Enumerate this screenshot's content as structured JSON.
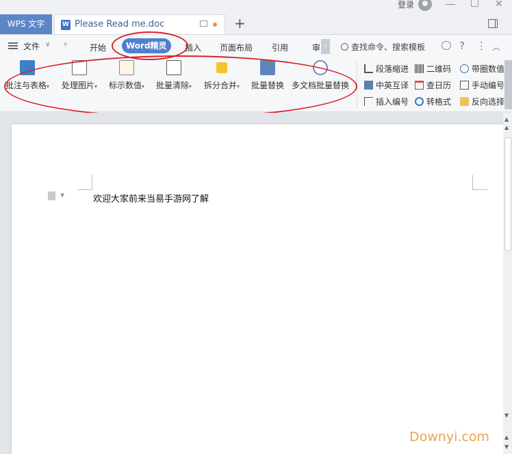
{
  "titlebar": {
    "app_tab": "WPS 文字",
    "doc_title": "Please Read me.doc",
    "login": "登录",
    "new_tab": "+"
  },
  "menubar": {
    "file": "文件",
    "tabs": [
      "开始",
      "Word精灵",
      "插入",
      "页面布局",
      "引用",
      "审"
    ],
    "active_tab": "Word精灵",
    "search": "查找命令、搜索模板"
  },
  "ribbon": {
    "buttons": [
      {
        "label": "批注与表格",
        "icon": "table-comment-icon",
        "dropdown": true
      },
      {
        "label": "处理图片",
        "icon": "image-icon",
        "dropdown": true
      },
      {
        "label": "标示数值",
        "icon": "pencil-icon",
        "dropdown": true
      },
      {
        "label": "批量清除",
        "icon": "clear-icon",
        "dropdown": true
      },
      {
        "label": "拆分合并",
        "icon": "split-merge-icon",
        "dropdown": true
      },
      {
        "label": "批量替换",
        "icon": "replace-icon",
        "dropdown": false
      },
      {
        "label": "多文档批量替换",
        "icon": "magnifier-icon",
        "dropdown": false
      }
    ],
    "small_items": [
      [
        "段落缩进",
        "二维码",
        "带圈数值"
      ],
      [
        "中英互译",
        "查日历",
        "手动编号"
      ],
      [
        "插入编号",
        "转格式",
        "反向选择"
      ]
    ]
  },
  "document": {
    "text": "欢迎大家前来当易手游网了解"
  },
  "watermark": "Downyi.com",
  "colors": {
    "accent": "#4f7fce",
    "annotation": "#d8232a",
    "watermark": "#e8a24b"
  }
}
